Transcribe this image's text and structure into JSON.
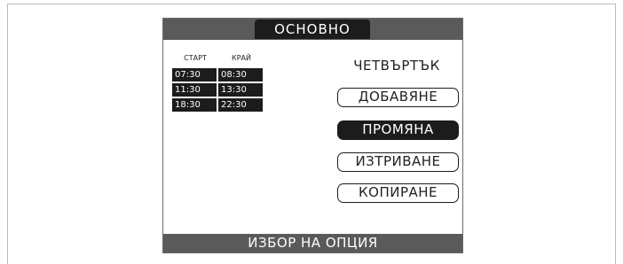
{
  "header": {
    "title": "ОСНОВНО"
  },
  "schedule": {
    "start_label": "СТАРТ",
    "end_label": "КРАЙ",
    "rows": [
      {
        "start": "07:30",
        "end": "08:30"
      },
      {
        "start": "11:30",
        "end": "13:30"
      },
      {
        "start": "18:30",
        "end": "22:30"
      }
    ]
  },
  "day": "ЧЕТВЪРТЪК",
  "options": [
    {
      "label": "ДОБАВЯНЕ",
      "selected": false
    },
    {
      "label": "ПРОМЯНА",
      "selected": true
    },
    {
      "label": "ИЗТРИВАНЕ",
      "selected": false
    },
    {
      "label": "КОПИРАНЕ",
      "selected": false
    }
  ],
  "footer": {
    "prompt": "ИЗБОР НА ОПЦИЯ"
  }
}
